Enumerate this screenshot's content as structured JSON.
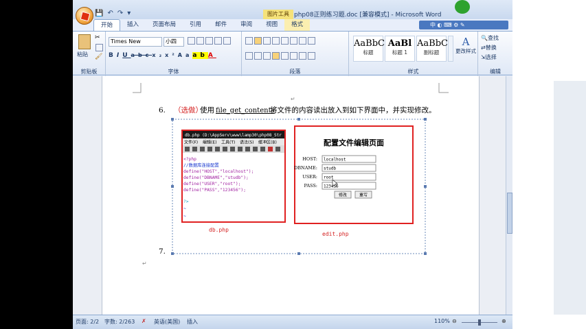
{
  "window": {
    "title": "php08正则练习题.doc [兼容模式] - Microsoft Word",
    "context_tab_label": "图片工具"
  },
  "tabs": [
    "开始",
    "插入",
    "页面布局",
    "引用",
    "邮件",
    "审阅",
    "视图",
    "格式"
  ],
  "ribbon": {
    "clipboard": {
      "label": "剪贴板",
      "paste": "粘贴"
    },
    "font": {
      "label": "字体",
      "font_name": "Times New Roman",
      "font_size": "小四"
    },
    "paragraph": {
      "label": "段落"
    },
    "styles": {
      "label": "样式",
      "items": [
        {
          "sample": "AaBbC",
          "name": "标题"
        },
        {
          "sample": "AaBl",
          "name": "标题 1"
        },
        {
          "sample": "AaBbC",
          "name": "副标题"
        }
      ],
      "change": "更改样式"
    },
    "editing": {
      "label": "编辑",
      "find": "查找",
      "replace": "替换",
      "select": "选择"
    },
    "ime_label": "中"
  },
  "document": {
    "item6_num": "6.",
    "item6_tag": "（选做）",
    "item6_pre": "使用",
    "item6_func": "file_get_contents",
    "item6_post": "将文件的内容读出放入到如下界面中，并实现修改。",
    "item7_num": "7.",
    "left_caption": "db.php",
    "right_caption": "edit.php",
    "editor": {
      "title": "db.php  (D:\\AppServ\\www\\lamp30\\php08_Str",
      "menu": [
        "文件(F)",
        "编辑(E)",
        "工具(T)",
        "语法(S)",
        "缓冲区(B)"
      ],
      "lines": [
        "<?php",
        "  //数据库连接配置",
        "  define(\"HOST\",\"localhost\");",
        "  define(\"DBNAME\",\"studb\");",
        "  define(\"USER\",\"root\");",
        "  define(\"PASS\",\"123456\");",
        "",
        "?>",
        "~",
        "~"
      ]
    },
    "form": {
      "title": "配置文件编辑页面",
      "fields": [
        {
          "label": "HOST:",
          "value": "localhost"
        },
        {
          "label": "DBNAME:",
          "value": "studb"
        },
        {
          "label": "USER:",
          "value": "root"
        },
        {
          "label": "PASS:",
          "value": "123456"
        }
      ],
      "submit": "修改",
      "reset": "重写"
    }
  },
  "status": {
    "page": "页面: 2/2",
    "words": "字数: 2/263",
    "lang": "英语(美国)",
    "mode": "插入",
    "zoom": "110%"
  },
  "colors": {
    "accent": "#e02020",
    "ribbon": "#dfe8f6"
  }
}
